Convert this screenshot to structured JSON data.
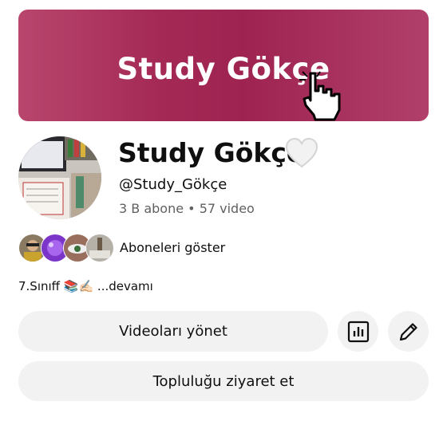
{
  "banner": {
    "text": "Study Gökçe",
    "color": "#a42955"
  },
  "channel": {
    "name": "Study Gökçe",
    "handle": "@Study_Gökçe",
    "subscribers": "3 B abone",
    "separator": "•",
    "video_count": "57 video"
  },
  "subscribers_row": {
    "label": "Aboneleri göster"
  },
  "description": {
    "text": "7.Sınıff 📚✍🏻",
    "more": "...devamı"
  },
  "buttons": {
    "manage_videos": "Videoları yönet",
    "analytics_icon": "analytics-icon",
    "edit_icon": "pencil-icon",
    "visit_community": "Topluluğu ziyaret et"
  }
}
